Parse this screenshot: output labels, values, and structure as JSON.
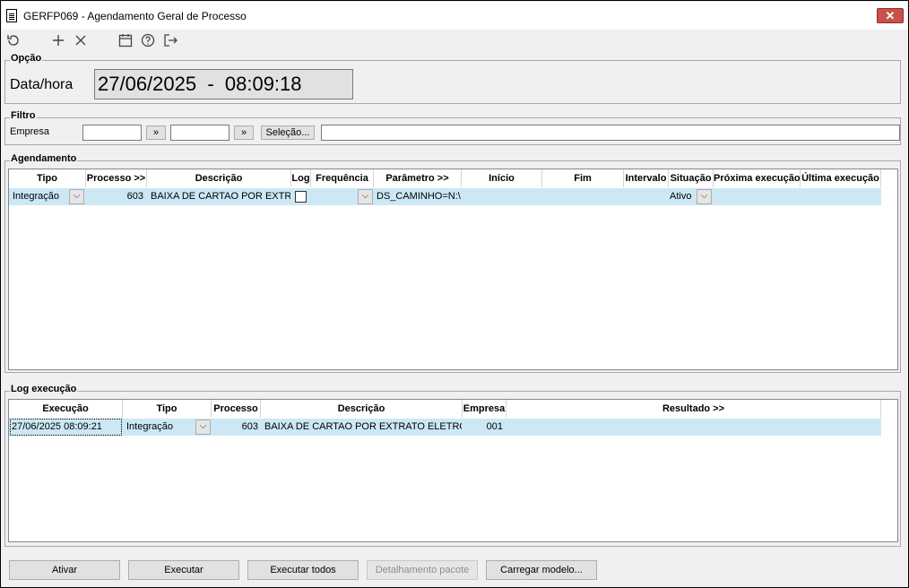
{
  "window": {
    "title": "GERFP069 - Agendamento Geral de Processo",
    "close_label": "✕"
  },
  "toolbar": {
    "icons": [
      "refresh-icon",
      "add-icon",
      "remove-icon",
      "calendar-icon",
      "help-icon",
      "exit-icon"
    ]
  },
  "opcao": {
    "legend": "Opção",
    "label": "Data/hora",
    "value": "27/06/2025  -  08:09:18"
  },
  "filtro": {
    "legend": "Filtro",
    "empresa_label": "Empresa",
    "empresa_from": "",
    "empresa_to": "",
    "jump_label": "»",
    "selecao_label": "Seleção...",
    "selection_text": ""
  },
  "agendamento": {
    "legend": "Agendamento",
    "columns": [
      "Tipo",
      "Processo >>",
      "Descrição",
      "Log",
      "Frequência",
      "Parâmetro >>",
      "Início",
      "Fim",
      "Intervalo",
      "Situação",
      "Próxima execução",
      "Última execução"
    ],
    "rows": [
      {
        "tipo": "Integração",
        "processo": "603",
        "descricao": "BAIXA DE CARTAO POR EXTRATO",
        "log": false,
        "frequencia": "",
        "parametro": "DS_CAMINHO=N:\\D",
        "inicio": "",
        "fim": "",
        "intervalo": "",
        "situacao": "Ativo",
        "proxima": "",
        "ultima": ""
      }
    ]
  },
  "log": {
    "legend": "Log execução",
    "columns": [
      "Execução",
      "Tipo",
      "Processo",
      "Descrição",
      "Empresa",
      "Resultado >>"
    ],
    "rows": [
      {
        "execucao": "27/06/2025 08:09:21",
        "tipo": "Integração",
        "processo": "603",
        "descricao": "BAIXA DE CARTAO POR EXTRATO ELETRON",
        "empresa": "001",
        "resultado": ""
      }
    ]
  },
  "buttons": {
    "ativar": "Ativar",
    "executar": "Executar",
    "executar_todos": "Executar todos",
    "detalhamento": "Detalhamento pacote",
    "carregar": "Carregar modelo..."
  }
}
